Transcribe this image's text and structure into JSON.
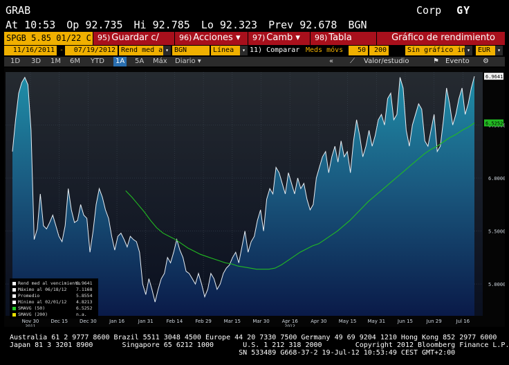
{
  "header": {
    "ticker": "GRAB",
    "source": "Corp",
    "brand": "GY",
    "at": "At 10:53",
    "open": "Op 92.735",
    "high": "Hi 92.785",
    "low": "Lo 92.323",
    "prev": "Prev 92.678",
    "currency": "BGN"
  },
  "toolbar": {
    "security": "SPGB 5.85 01/22 C",
    "buttons": [
      {
        "num": "95)",
        "label": "Guardar c/"
      },
      {
        "num": "96)",
        "label": "Acciones ▾"
      },
      {
        "num": "97)",
        "label": "Camb ▾"
      },
      {
        "num": "98)",
        "label": "Tabla"
      }
    ],
    "title": "Gráfico de rendimiento"
  },
  "params": {
    "start_date": "11/16/2011",
    "end_date": "07/19/2012",
    "field": "Rend med a",
    "source": "BGN",
    "style": "Línea",
    "compare": "11) Comparar",
    "mavg_label": "Meds móvs",
    "mavg1": "50",
    "mavg2": "200",
    "chart_opt": "Sin gráfico infer",
    "curr": "EUR",
    "sep": "-"
  },
  "tabs": [
    "1D",
    "3D",
    "1M",
    "6M",
    "YTD",
    "1A",
    "5A",
    "Máx",
    "Diario ▾"
  ],
  "active_tab": "1A",
  "tabs_right": {
    "collapse": "«",
    "value_study": "Valor/estudio",
    "event": "Evento",
    "gear": "⚙"
  },
  "chart_data": {
    "type": "area",
    "x_labels": [
      "Nov 30",
      "Dec 15",
      "Dec 30",
      "Jan 16",
      "Jan 31",
      "Feb 14",
      "Feb 29",
      "Mar 15",
      "Mar 30",
      "Apr 16",
      "Apr 30",
      "May 15",
      "May 31",
      "Jun 15",
      "Jun 29",
      "Jul 16"
    ],
    "year_labels": [
      {
        "label": "2011",
        "at": "Nov 30"
      },
      {
        "label": "2012",
        "at": "Apr 16"
      }
    ],
    "y_ticks": [
      5.0,
      5.5,
      6.0,
      6.5
    ],
    "ylim": [
      4.7,
      7.0
    ],
    "last_value_label": "6.9641",
    "mavg_value_label": "6.5252",
    "series": [
      {
        "name": "Rend med al vencimiento",
        "values": [
          6.25,
          6.55,
          6.8,
          6.9,
          6.95,
          6.88,
          6.45,
          5.42,
          5.52,
          5.85,
          5.55,
          5.52,
          5.58,
          5.65,
          5.55,
          5.45,
          5.4,
          5.55,
          5.9,
          5.7,
          5.58,
          5.6,
          5.75,
          5.65,
          5.62,
          5.3,
          5.5,
          5.75,
          5.9,
          5.82,
          5.7,
          5.62,
          5.45,
          5.32,
          5.45,
          5.48,
          5.42,
          5.35,
          5.45,
          5.42,
          5.4,
          5.3,
          5.0,
          4.9,
          5.05,
          4.95,
          4.83,
          4.95,
          5.05,
          5.1,
          5.25,
          5.2,
          5.3,
          5.42,
          5.32,
          5.25,
          5.12,
          5.1,
          5.05,
          5.0,
          5.1,
          5.0,
          4.88,
          4.95,
          5.1,
          5.05,
          4.95,
          5.0,
          5.1,
          5.15,
          5.18,
          5.25,
          5.3,
          5.2,
          5.35,
          5.5,
          5.3,
          5.4,
          5.45,
          5.6,
          5.7,
          5.5,
          5.8,
          5.9,
          5.85,
          6.1,
          6.05,
          5.95,
          5.85,
          6.05,
          5.95,
          5.85,
          6.0,
          5.9,
          5.95,
          5.8,
          5.7,
          5.75,
          6.0,
          6.1,
          6.2,
          6.25,
          6.05,
          6.2,
          6.3,
          6.15,
          6.35,
          6.2,
          6.25,
          6.05,
          6.35,
          6.55,
          6.4,
          6.2,
          6.3,
          6.45,
          6.3,
          6.4,
          6.55,
          6.6,
          6.5,
          6.75,
          6.8,
          6.55,
          6.6,
          6.95,
          6.85,
          6.45,
          6.3,
          6.5,
          6.6,
          6.7,
          6.65,
          6.35,
          6.3,
          6.45,
          6.6,
          6.25,
          6.3,
          6.55,
          6.85,
          6.7,
          6.5,
          6.6,
          6.75,
          6.85,
          6.6,
          6.7,
          6.85,
          6.96
        ]
      },
      {
        "name": "SMAVG (50)",
        "values": [
          5.88,
          5.82,
          5.75,
          5.68,
          5.6,
          5.53,
          5.48,
          5.45,
          5.42,
          5.38,
          5.34,
          5.31,
          5.28,
          5.26,
          5.24,
          5.22,
          5.2,
          5.19,
          5.17,
          5.16,
          5.15,
          5.14,
          5.14,
          5.14,
          5.15,
          5.18,
          5.22,
          5.26,
          5.3,
          5.33,
          5.36,
          5.38,
          5.42,
          5.46,
          5.5,
          5.55,
          5.6,
          5.66,
          5.72,
          5.78,
          5.83,
          5.88,
          5.93,
          5.98,
          6.03,
          6.08,
          6.13,
          6.18,
          6.23,
          6.27,
          6.3,
          6.34,
          6.38,
          6.41,
          6.45,
          6.48,
          6.52
        ]
      }
    ],
    "legend": [
      {
        "label": "Rend med al vencimiento",
        "value": "6.9641",
        "color": "#ffffff"
      },
      {
        "label": "Máximo al 06/18/12",
        "value": "7.1168",
        "color": "#ffffff"
      },
      {
        "label": "Promedio",
        "value": "5.8554",
        "color": "#ffffff"
      },
      {
        "label": "Mínimo al 02/01/12",
        "value": "4.8213",
        "color": "#ffffff"
      },
      {
        "label": "SMAVG (50)",
        "value": "6.5252",
        "color": "#22cc22"
      },
      {
        "label": "SMAVG (200)",
        "value": "n.a.",
        "color": "#e8e000"
      }
    ]
  },
  "footer": {
    "line1": "Australia 61 2 9777 8600 Brazil 5511 3048 4500 Europe 44 20 7330 7500 Germany 49 69 9204 1210 Hong Kong 852 2977 6000",
    "line2": "Japan 81 3 3201 8900       Singapore 65 6212 1000       U.S. 1 212 318 2000        Copyright 2012 Bloomberg Finance L.P.",
    "line3": "                                                       SN 533489 G668-37-2 19-Jul-12 10:53:49 CEST GMT+2:00"
  }
}
